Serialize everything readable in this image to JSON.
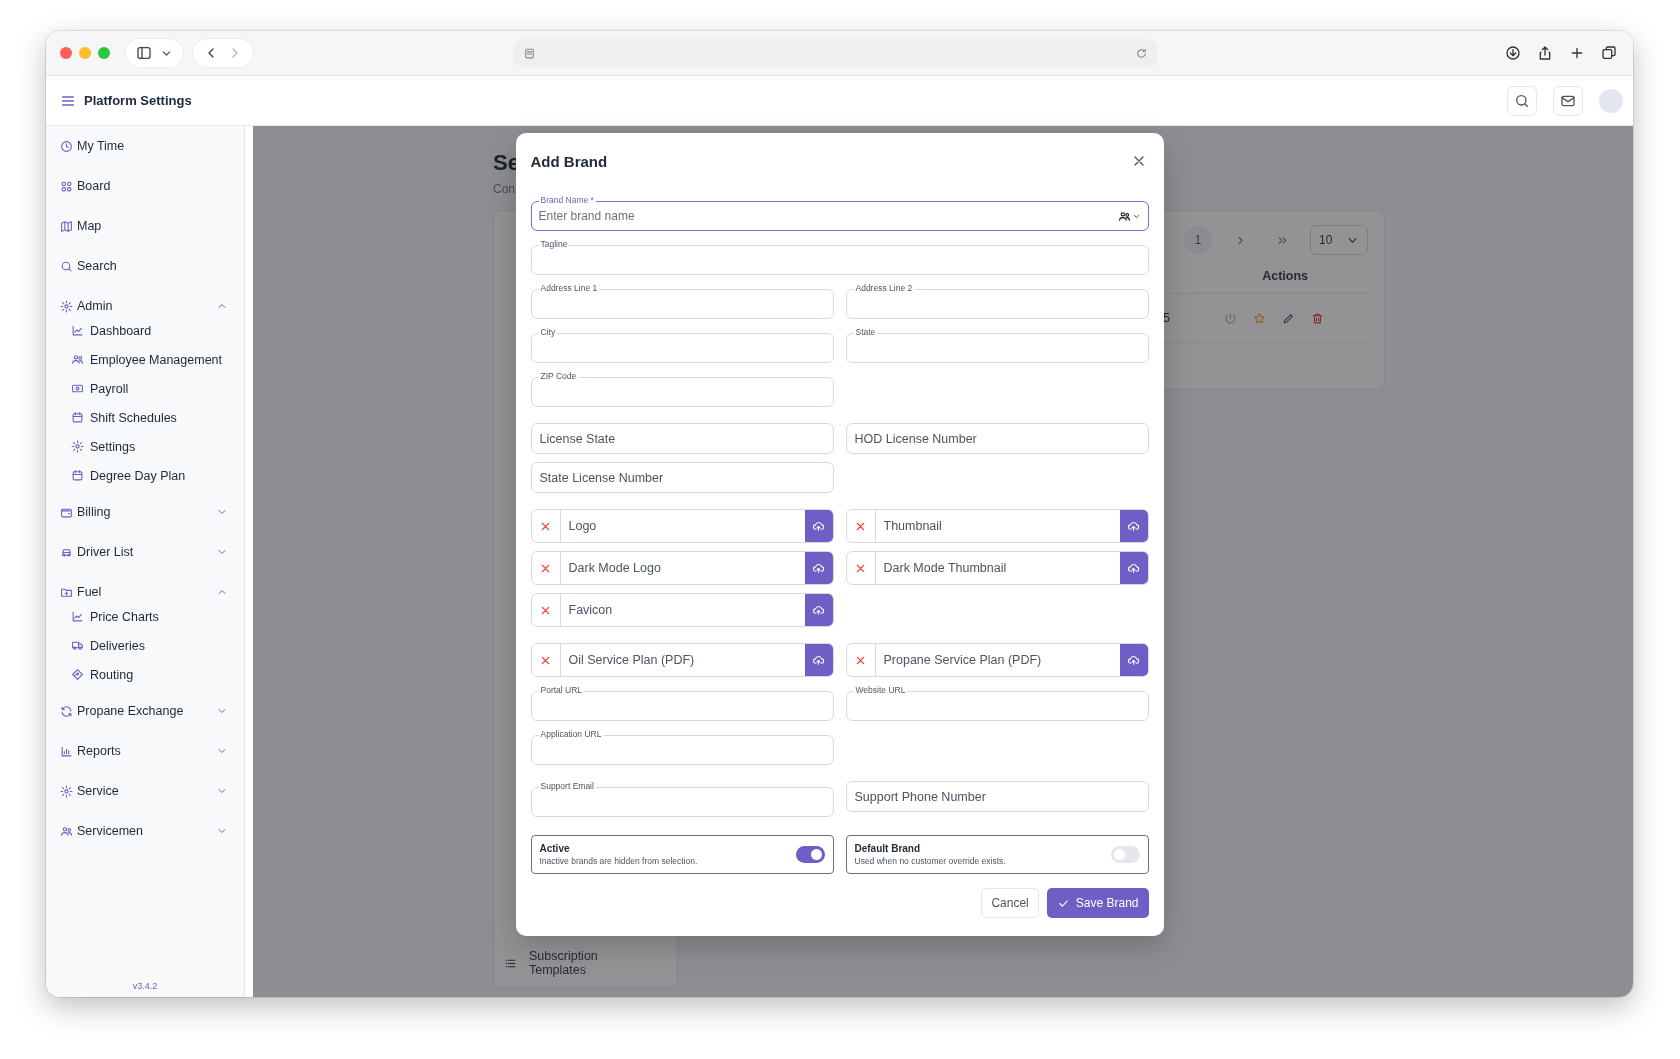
{
  "header": {
    "title": "Platform Settings"
  },
  "sidebar": {
    "items": [
      {
        "kind": "link",
        "label": "My Time"
      },
      {
        "kind": "link",
        "label": "Board"
      },
      {
        "kind": "link",
        "label": "Map"
      },
      {
        "kind": "link",
        "label": "Search"
      },
      {
        "kind": "group",
        "label": "Admin",
        "expanded": true,
        "children": [
          {
            "label": "Dashboard"
          },
          {
            "label": "Employee Management"
          },
          {
            "label": "Payroll"
          },
          {
            "label": "Shift Schedules"
          },
          {
            "label": "Settings"
          },
          {
            "label": "Degree Day Plan"
          }
        ]
      },
      {
        "kind": "group",
        "label": "Billing",
        "expanded": false
      },
      {
        "kind": "group",
        "label": "Driver List",
        "expanded": false
      },
      {
        "kind": "group",
        "label": "Fuel",
        "expanded": true,
        "children": [
          {
            "label": "Price Charts"
          },
          {
            "label": "Deliveries"
          },
          {
            "label": "Routing"
          }
        ]
      },
      {
        "kind": "group",
        "label": "Propane Exchange",
        "expanded": false
      },
      {
        "kind": "group",
        "label": "Reports",
        "expanded": false
      },
      {
        "kind": "group",
        "label": "Service",
        "expanded": false
      },
      {
        "kind": "group",
        "label": "Servicemen",
        "expanded": false
      }
    ],
    "version": "v3.4.2"
  },
  "page": {
    "title": "Se",
    "subtitle": "Con",
    "subnav": [
      {
        "label": "Subscription Templates"
      }
    ],
    "pagination": {
      "page": "1",
      "page_size": "10"
    },
    "table": {
      "columns": [
        "Actions"
      ],
      "rows": [
        {
          "cell": "5"
        }
      ]
    }
  },
  "modal": {
    "title": "Add Brand",
    "sections": [
      {
        "rows": [
          [
            {
              "kind": "outlined",
              "label": "Brand Name *",
              "placeholder": "Enter brand name",
              "full": true,
              "focused": true
            }
          ],
          [
            {
              "kind": "outlined",
              "label": "Tagline",
              "full": true,
              "focused": false
            }
          ],
          [
            {
              "kind": "outlined",
              "label": "Address Line 1",
              "focused": false
            },
            {
              "kind": "outlined",
              "label": "Address Line 2",
              "focused": false
            }
          ],
          [
            {
              "kind": "outlined",
              "label": "City",
              "focused": false
            },
            {
              "kind": "outlined",
              "label": "State",
              "focused": false
            }
          ],
          [
            {
              "kind": "outlined",
              "label": "ZIP Code",
              "focused": false
            }
          ]
        ]
      },
      {
        "rows": [
          [
            {
              "kind": "plain",
              "placeholder": "License State",
              "focused": false
            },
            {
              "kind": "plain",
              "placeholder": "HOD License Number",
              "focused": false
            }
          ],
          [
            {
              "kind": "plain",
              "placeholder": "State License Number",
              "focused": false
            }
          ]
        ]
      },
      {
        "rows": [
          [
            {
              "kind": "upload",
              "placeholder": "Logo"
            },
            {
              "kind": "upload",
              "placeholder": "Thumbnail"
            }
          ],
          [
            {
              "kind": "upload",
              "placeholder": "Dark Mode Logo"
            },
            {
              "kind": "upload",
              "placeholder": "Dark Mode Thumbnail"
            }
          ],
          [
            {
              "kind": "upload",
              "placeholder": "Favicon"
            }
          ]
        ]
      },
      {
        "rows": [
          [
            {
              "kind": "upload",
              "placeholder": "Oil Service Plan (PDF)"
            },
            {
              "kind": "upload",
              "placeholder": "Propane Service Plan (PDF)"
            }
          ],
          [
            {
              "kind": "outlined",
              "label": "Portal URL",
              "focused": false
            },
            {
              "kind": "outlined",
              "label": "Website URL",
              "focused": false
            }
          ],
          [
            {
              "kind": "outlined",
              "label": "Application URL",
              "focused": false
            }
          ]
        ]
      },
      {
        "rows": [
          [
            {
              "kind": "outlined",
              "label": "Support Email",
              "focused": false
            },
            {
              "kind": "plain",
              "placeholder": "Support Phone Number",
              "focused": false
            }
          ]
        ]
      }
    ],
    "toggles": [
      {
        "title": "Active",
        "description": "Inactive brands are hidden from selection.",
        "on": true
      },
      {
        "title": "Default Brand",
        "description": "Used when no customer override exists.",
        "on": false
      }
    ],
    "buttons": {
      "cancel": "Cancel",
      "save": "Save Brand"
    }
  }
}
